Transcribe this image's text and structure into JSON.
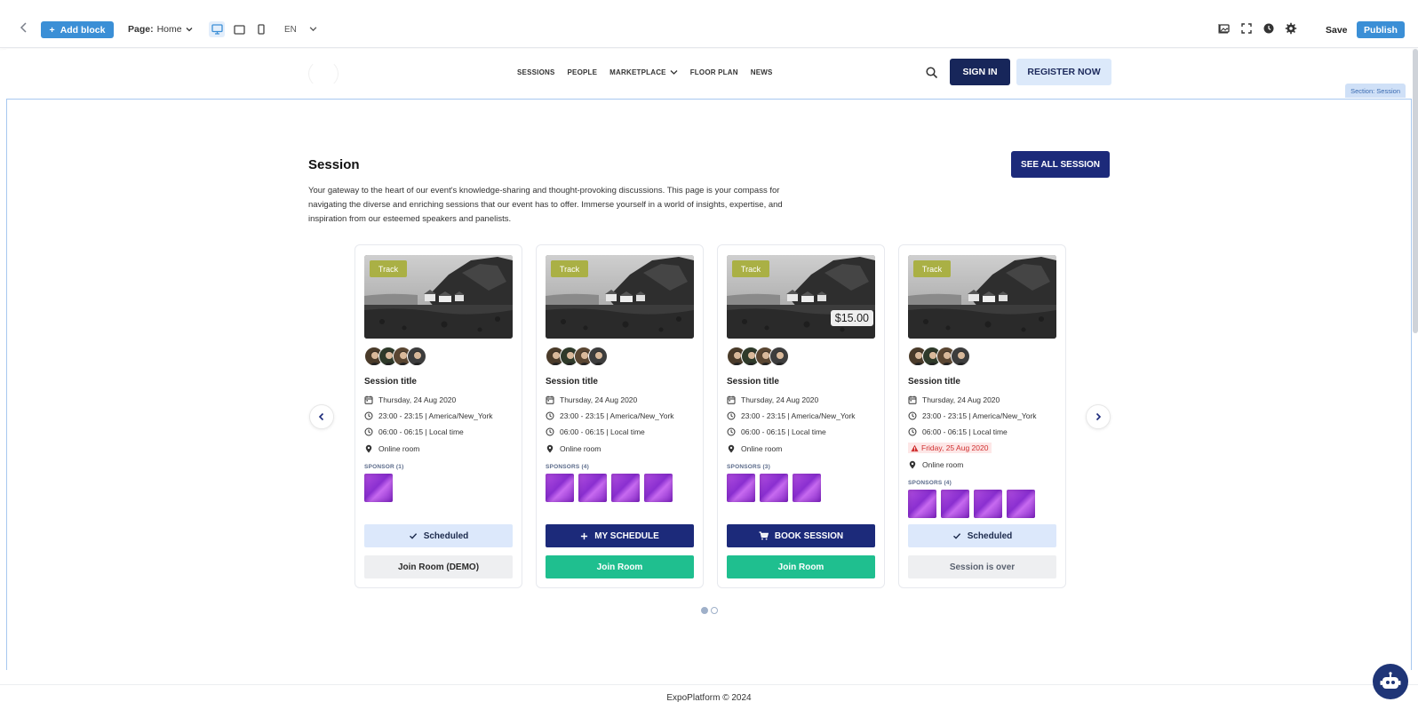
{
  "toolbar": {
    "add_block": "Add block",
    "page_label": "Page:",
    "page_value": "Home",
    "language": "EN",
    "save": "Save",
    "publish": "Publish",
    "accent": "#3b8fd6"
  },
  "header": {
    "nav": [
      "SESSIONS",
      "PEOPLE",
      "MARKETPLACE",
      "FLOOR PLAN",
      "NEWS"
    ],
    "sign_in": "SIGN IN",
    "register": "REGISTER NOW"
  },
  "section": {
    "tag": "Section: Session",
    "title": "Session",
    "description": "Your gateway to the heart of our event's knowledge-sharing and thought-provoking discussions. This page is your compass for navigating the diverse and enriching sessions that our event has to offer. Immerse yourself in a world of insights, expertise, and inspiration from our esteemed speakers and panelists.",
    "see_all": "SEE ALL SESSION"
  },
  "cards": [
    {
      "track": "Track",
      "price": "",
      "title": "Session title",
      "date": "Thursday, 24 Aug 2020",
      "time_tz": "23:00 - 23:15 | America/New_York",
      "time_local": "06:00 - 06:15 | Local time",
      "warning": "",
      "location": "Online room",
      "sponsor_label": "SPONSOR (1)",
      "sponsor_count": 1,
      "primary_button": "Scheduled",
      "secondary_button": "Join Room (DEMO)"
    },
    {
      "track": "Track",
      "price": "",
      "title": "Session title",
      "date": "Thursday, 24 Aug 2020",
      "time_tz": "23:00 - 23:15 | America/New_York",
      "time_local": "06:00 - 06:15 | Local time",
      "warning": "",
      "location": "Online room",
      "sponsor_label": "SPONSORS (4)",
      "sponsor_count": 4,
      "primary_button": "MY SCHEDULE",
      "secondary_button": "Join Room"
    },
    {
      "track": "Track",
      "price": "$15.00",
      "title": "Session title",
      "date": "Thursday, 24 Aug 2020",
      "time_tz": "23:00 - 23:15 | America/New_York",
      "time_local": "06:00 - 06:15 | Local time",
      "warning": "",
      "location": "Online room",
      "sponsor_label": "SPONSORS (3)",
      "sponsor_count": 3,
      "primary_button": "BOOK SESSION",
      "secondary_button": "Join Room"
    },
    {
      "track": "Track",
      "price": "",
      "title": "Session title",
      "date": "Thursday, 24 Aug 2020",
      "time_tz": "23:00 - 23:15 | America/New_York",
      "time_local": "06:00 - 06:15 | Local time",
      "warning": "Friday, 25 Aug 2020",
      "location": "Online room",
      "sponsor_label": "SPONSORS (4)",
      "sponsor_count": 4,
      "primary_button": "Scheduled",
      "secondary_button": "Session is over"
    }
  ],
  "carousel": {
    "page": 1,
    "pages": 2
  },
  "footer": {
    "text": "ExpoPlatform © 2024"
  },
  "colors": {
    "navy": "#1c2a7a",
    "green": "#1fbf8f",
    "track": "#aab045",
    "scheduled": "#dce8fb",
    "warning": "#d03030"
  }
}
